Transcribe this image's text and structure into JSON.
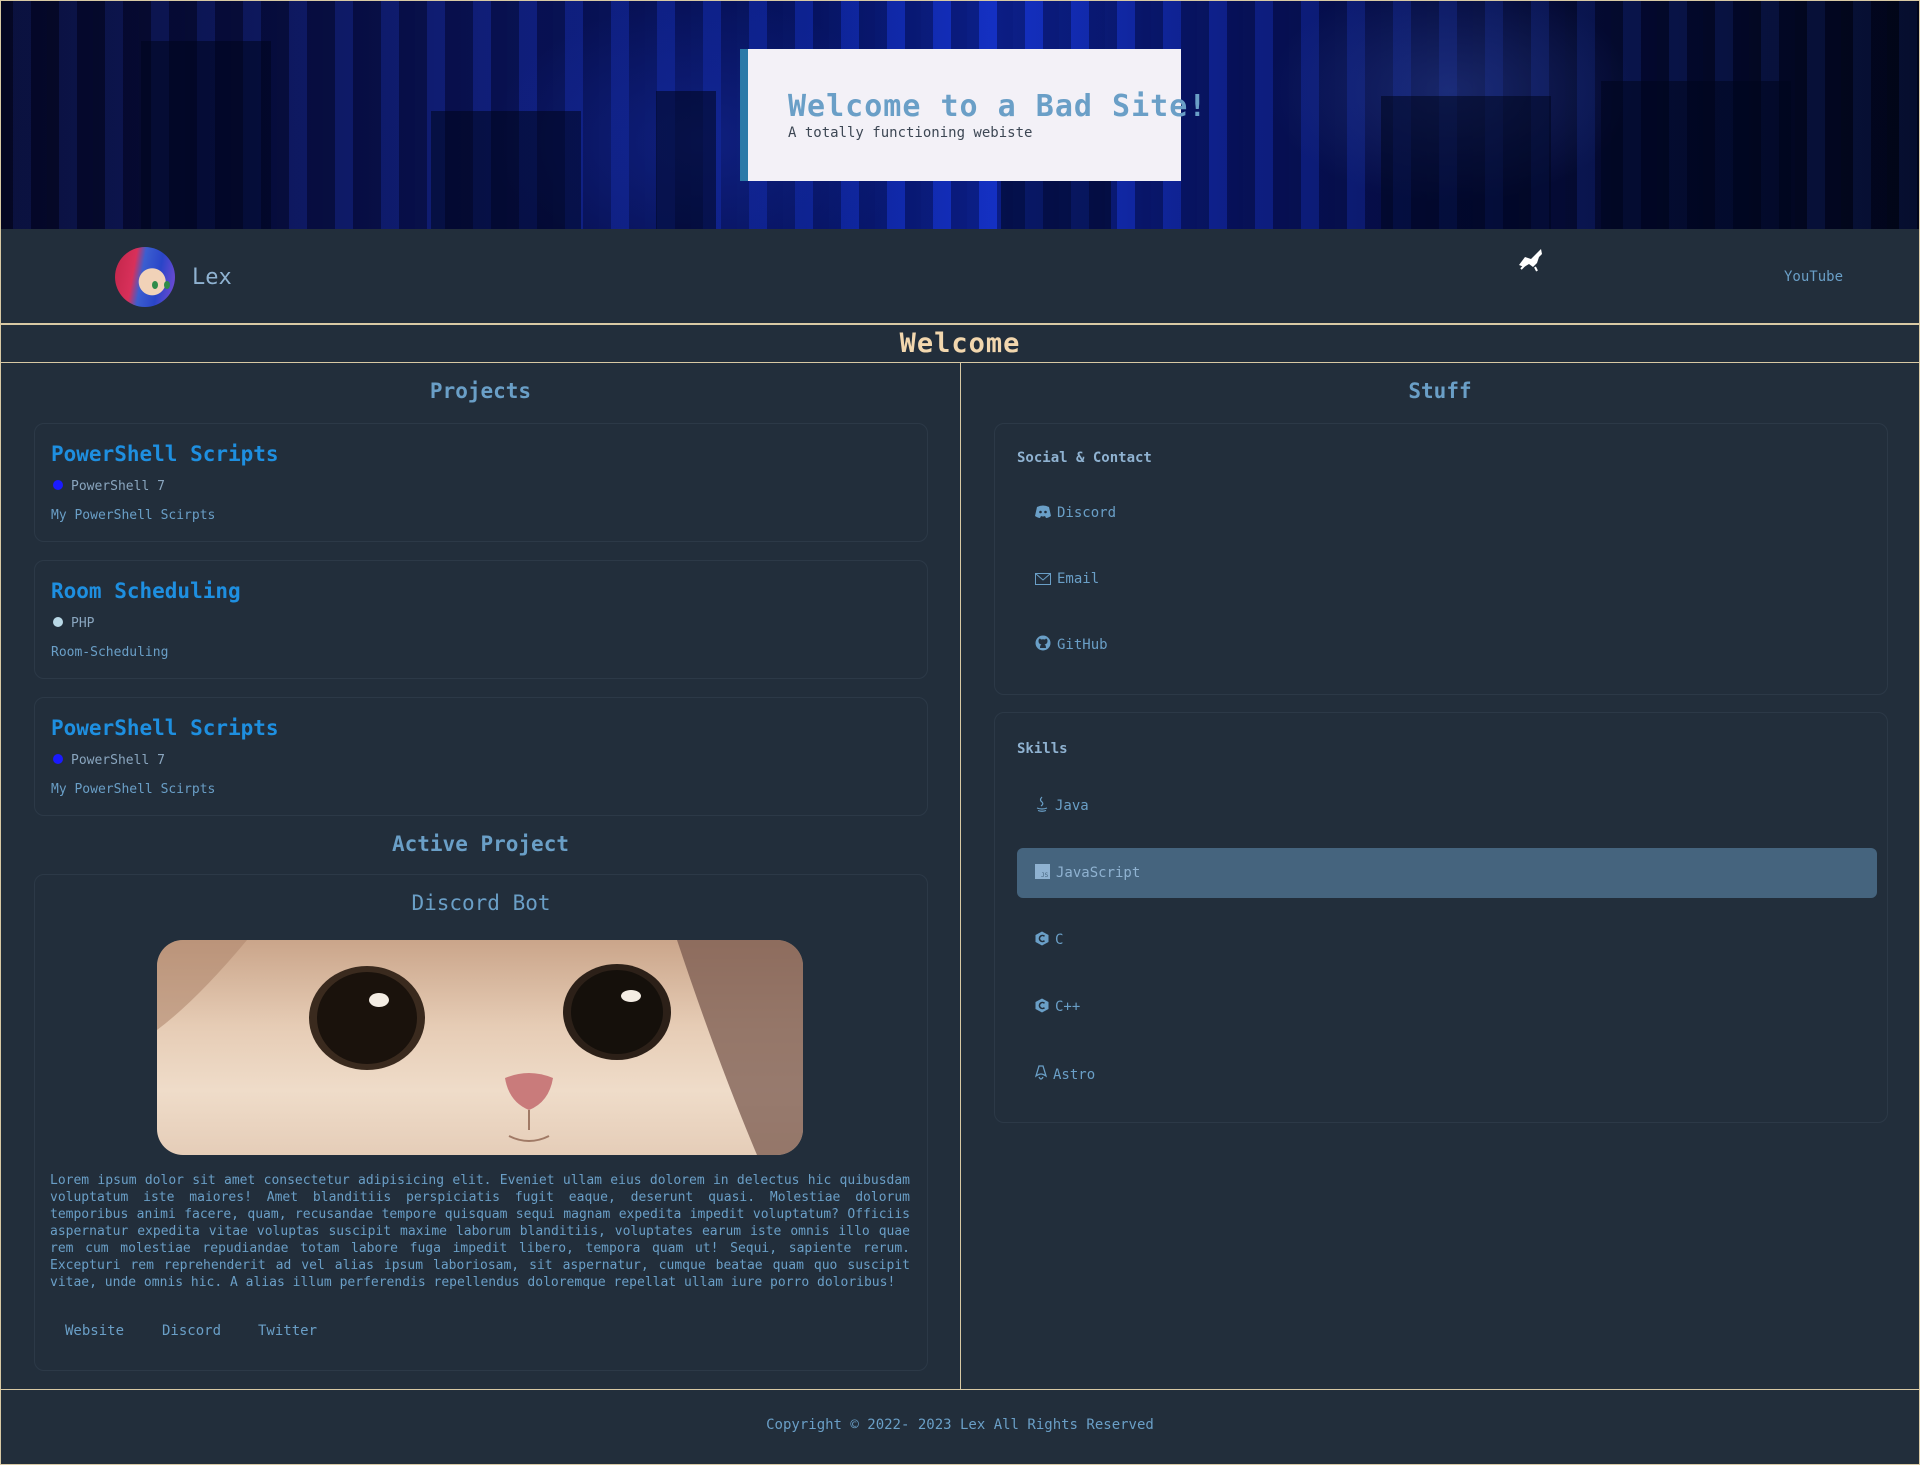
{
  "banner": {
    "title": "Welcome to a Bad Site!",
    "subtitle": "A totally functioning webiste"
  },
  "navbar": {
    "name": "Lex",
    "links": [
      "YouTube"
    ]
  },
  "section": {
    "title": "Welcome"
  },
  "projects": {
    "heading": "Projects",
    "items": [
      {
        "title": "PowerShell Scripts",
        "language": "PowerShell 7",
        "language_color": "#1a1aff",
        "description": "My PowerShell Scirpts"
      },
      {
        "title": "Room Scheduling",
        "language": "PHP",
        "language_color": "#b9d8e6",
        "description": "Room-Scheduling"
      },
      {
        "title": "PowerShell Scripts",
        "language": "PowerShell 7",
        "language_color": "#1a1aff",
        "description": "My PowerShell Scirpts"
      }
    ]
  },
  "active_project": {
    "heading": "Active Project",
    "title": "Discord Bot",
    "description": "Lorem ipsum dolor sit amet consectetur adipisicing elit. Eveniet ullam eius dolorem in delectus hic quibusdam voluptatum iste maiores! Amet blanditiis perspiciatis fugit eaque, deserunt quasi. Molestiae dolorum temporibus animi facere, quam, recusandae tempore quisquam sequi magnam expedita impedit voluptatum? Officiis aspernatur expedita vitae voluptas suscipit maxime laborum blanditiis, voluptates earum iste omnis illo quae rem cum molestiae repudiandae totam labore fuga impedit libero, tempora quam ut! Sequi, sapiente rerum. Excepturi rem reprehenderit ad vel alias ipsum laboriosam, sit aspernatur, cumque beatae quam quo suscipit vitae, unde omnis hic. A alias illum perferendis repellendus doloremque repellat ullam iure porro doloribus!",
    "links": [
      "Website",
      "Discord",
      "Twitter"
    ]
  },
  "stuff": {
    "heading": "Stuff",
    "social": {
      "title": "Social & Contact",
      "items": [
        {
          "label": "Discord",
          "icon": "discord-icon"
        },
        {
          "label": "Email",
          "icon": "mail-icon"
        },
        {
          "label": "GitHub",
          "icon": "github-icon"
        }
      ]
    },
    "skills": {
      "title": "Skills",
      "items": [
        {
          "label": "Java",
          "icon": "java-icon"
        },
        {
          "label": "JavaScript",
          "icon": "javascript-icon",
          "selected": true
        },
        {
          "label": "C",
          "icon": "c-icon"
        },
        {
          "label": "C++",
          "icon": "cpp-icon"
        },
        {
          "label": "Astro",
          "icon": "astro-icon"
        }
      ]
    }
  },
  "footer": {
    "text": "Copyright © 2022- 2023 Lex All Rights Reserved"
  },
  "colors": {
    "background": "#222e3b",
    "accent": "#6a9fc7",
    "border": "#d8c9a4",
    "highlight": "#f2d7ae",
    "link": "#1e8fe0",
    "selected": "#45647e"
  }
}
